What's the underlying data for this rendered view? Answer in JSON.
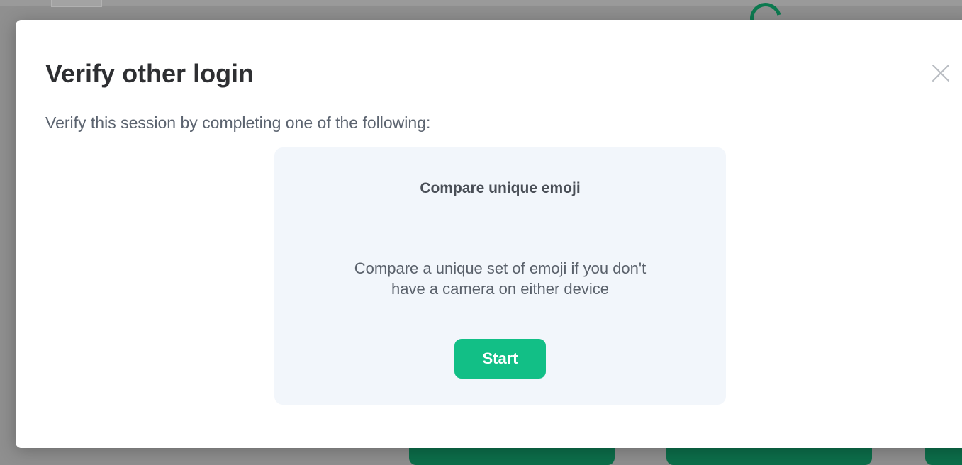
{
  "dialog": {
    "title": "Verify other login",
    "description": "Verify this session by completing one of the following:",
    "close_icon": "close-icon"
  },
  "option": {
    "title": "Compare unique emoji",
    "description_line1": "Compare a unique set of emoji if you don't",
    "description_line2": "have a camera on either device",
    "start_label": "Start"
  },
  "colors": {
    "accent": "#12bf86",
    "card_background": "#f2f6fb",
    "overlay": "#8f8f8f"
  }
}
